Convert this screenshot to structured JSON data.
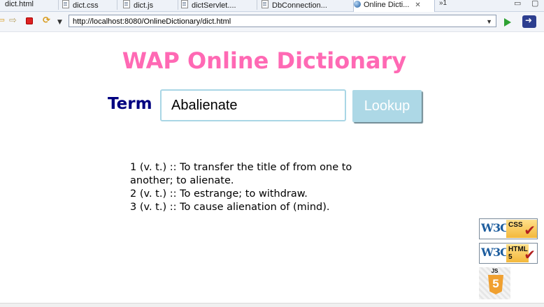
{
  "tabs": [
    {
      "label": "dict.html",
      "icon": "file-icon",
      "active": false
    },
    {
      "label": "dict.css",
      "icon": "file-icon",
      "active": false
    },
    {
      "label": "dict.js",
      "icon": "file-icon",
      "active": false
    },
    {
      "label": "dictServlet....",
      "icon": "file-icon",
      "active": false
    },
    {
      "label": "DbConnection...",
      "icon": "file-icon",
      "active": false
    },
    {
      "label": "Online Dicti...",
      "icon": "globe-icon",
      "active": true,
      "close": "✕"
    }
  ],
  "tab_overflow": "»1",
  "browser": {
    "url": "http://localhost:8080/OnlineDictionary/dict.html"
  },
  "page": {
    "title": "WAP Online Dictionary",
    "term_label": "Term",
    "term_value": "Abalienate",
    "lookup_label": "Lookup",
    "definitions": [
      "1 (v. t.) :: To transfer the title of from one to another; to alienate.",
      "2 (v. t.) :: To estrange; to withdraw.",
      "3 (v. t.) :: To cause alienation of (mind)."
    ]
  },
  "badges": {
    "css": {
      "w3c": "W3C",
      "label": "CSS"
    },
    "html": {
      "w3c": "W3C",
      "label": "HTML 5"
    },
    "js": {
      "label": "JS",
      "number": "5"
    }
  },
  "colors": {
    "title": "#ff69b4",
    "term_label": "#000080",
    "lookup_bg": "#add8e6",
    "input_border": "#a9d6e5"
  }
}
